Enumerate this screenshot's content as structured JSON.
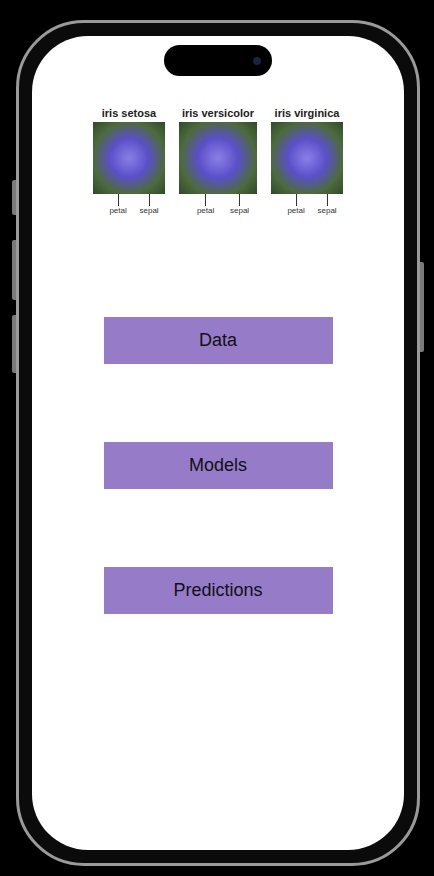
{
  "figure": {
    "species": [
      {
        "name": "iris setosa",
        "labels": [
          "petal",
          "sepal"
        ]
      },
      {
        "name": "iris versicolor",
        "labels": [
          "petal",
          "sepal"
        ]
      },
      {
        "name": "iris virginica",
        "labels": [
          "petal",
          "sepal"
        ]
      }
    ]
  },
  "buttons": [
    {
      "label": "Data"
    },
    {
      "label": "Models"
    },
    {
      "label": "Predictions"
    }
  ]
}
